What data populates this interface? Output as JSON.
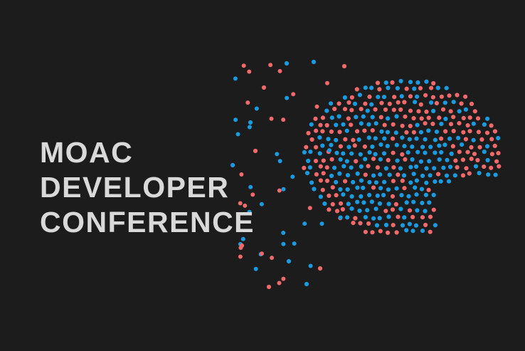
{
  "title": {
    "line1": "MOAC",
    "line2": "DEVELOPER",
    "line3": "CONFERENCE"
  },
  "colors": {
    "background": "#1c1c1c",
    "text": "#d9d9d9",
    "dot_blue": "#1a9be0",
    "dot_red": "#f0696b"
  },
  "illustration": {
    "icon": "dotted-brain-icon"
  }
}
